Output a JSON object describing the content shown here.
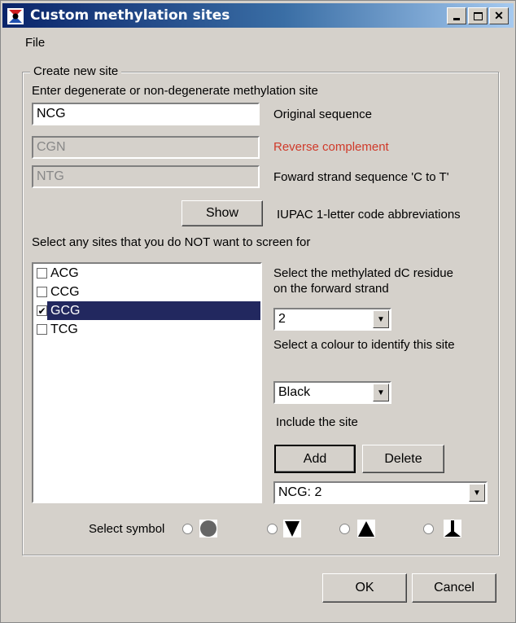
{
  "window": {
    "title": "Custom methylation sites",
    "controls": [
      "minimize",
      "maximize",
      "close"
    ]
  },
  "menu": {
    "file": "File"
  },
  "group": {
    "legend": "Create new site",
    "instruction": "Enter degenerate or non-degenerate methylation site",
    "original": {
      "value": "NCG",
      "label": "Original sequence"
    },
    "reverse": {
      "value": "CGN",
      "label": "Reverse complement",
      "label_color": "#d03a2a"
    },
    "forward": {
      "value": "NTG",
      "label": "Foward strand sequence 'C to T'"
    },
    "show_button": "Show",
    "iupac_label": "IUPAC 1-letter code abbreviations",
    "select_sites_label": "Select any sites that you do NOT want to screen for",
    "sites": [
      {
        "label": "ACG",
        "checked": false,
        "selected": false
      },
      {
        "label": "CCG",
        "checked": false,
        "selected": false
      },
      {
        "label": "GCG",
        "checked": true,
        "selected": true
      },
      {
        "label": "TCG",
        "checked": false,
        "selected": false
      }
    ],
    "residue_label_1": "Select the methylated dC residue",
    "residue_label_2": "on the forward strand",
    "residue_value": "2",
    "colour_label": "Select a colour to identify this site",
    "colour_value": "Black",
    "include_label": "Include the site",
    "add_button": "Add",
    "delete_button": "Delete",
    "sites_combo_value": "NCG: 2",
    "symbol_label": "Select symbol",
    "symbols": [
      "circle",
      "triangle-down",
      "triangle-up",
      "inverted-t"
    ]
  },
  "footer": {
    "ok": "OK",
    "cancel": "Cancel"
  }
}
